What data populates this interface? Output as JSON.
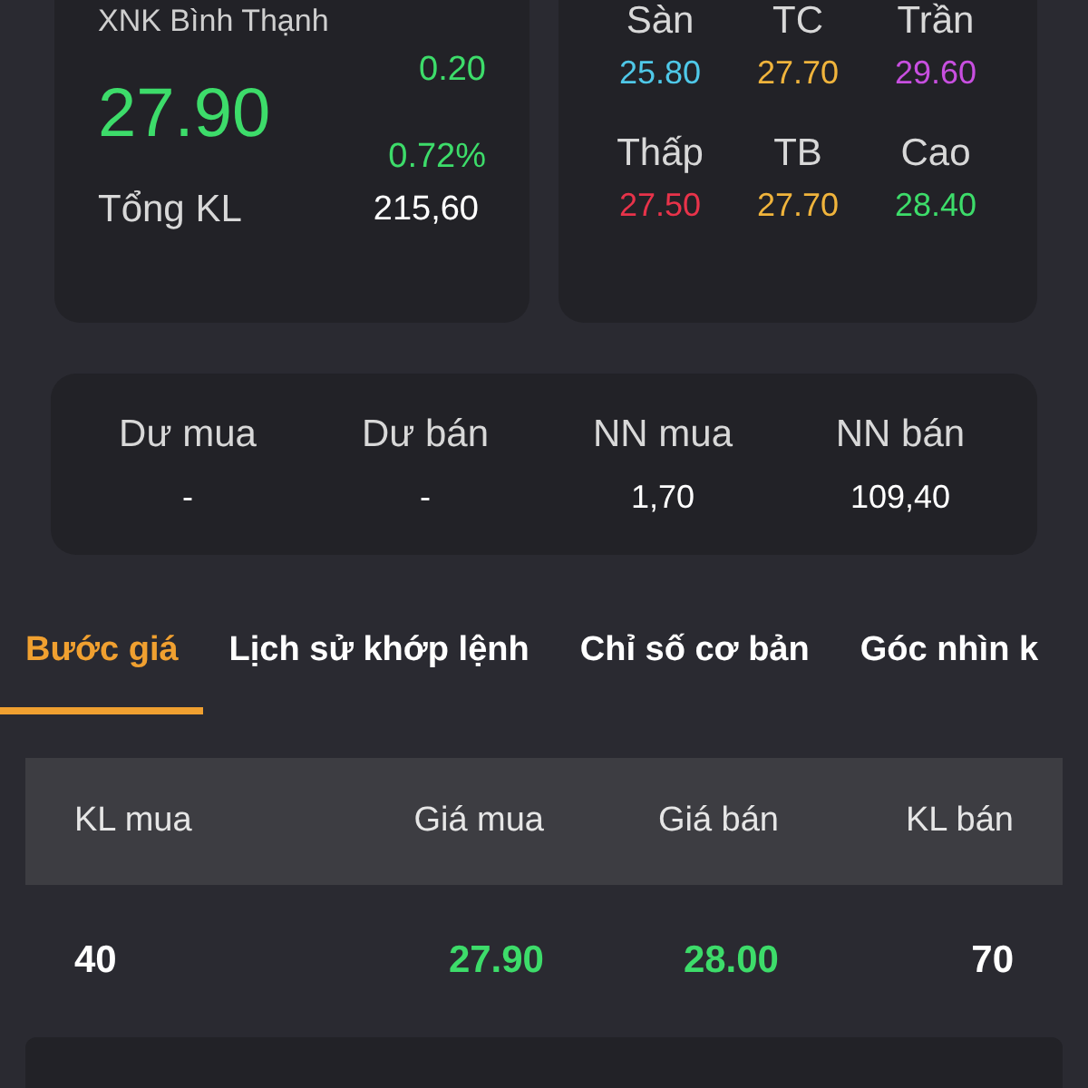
{
  "quote": {
    "name": "XNK Bình Thạnh",
    "price": "27.90",
    "change": "0.20",
    "change_percent": "0.72%",
    "color": "#3ddc6a",
    "total_volume_label": "Tổng KL",
    "total_volume": "215,60"
  },
  "price_levels": [
    {
      "label": "Sàn",
      "value": "25.80",
      "color": "#4fc8e8"
    },
    {
      "label": "TC",
      "value": "27.70",
      "color": "#f0b43c"
    },
    {
      "label": "Trần",
      "value": "29.60",
      "color": "#c84fe0"
    },
    {
      "label": "Thấp",
      "value": "27.50",
      "color": "#e8334a"
    },
    {
      "label": "TB",
      "value": "27.70",
      "color": "#f0b43c"
    },
    {
      "label": "Cao",
      "value": "28.40",
      "color": "#3ddc6a"
    }
  ],
  "orders": [
    {
      "label": "Dư mua",
      "value": "-"
    },
    {
      "label": "Dư bán",
      "value": "-"
    },
    {
      "label": "NN mua",
      "value": "1,70"
    },
    {
      "label": "NN bán",
      "value": "109,40"
    }
  ],
  "tabs": [
    {
      "label": "Bước giá",
      "selected": true
    },
    {
      "label": "Lịch sử khớp lệnh",
      "selected": false
    },
    {
      "label": "Chỉ số cơ bản",
      "selected": false
    },
    {
      "label": "Góc nhìn k",
      "selected": false
    }
  ],
  "table": {
    "columns": [
      "KL mua",
      "Giá mua",
      "Giá bán",
      "KL bán"
    ],
    "rows": [
      {
        "buy_volume": "40",
        "buy_price": "27.90",
        "sell_price": "28.00",
        "sell_volume": "70",
        "color": "#3ddc6a"
      }
    ]
  }
}
